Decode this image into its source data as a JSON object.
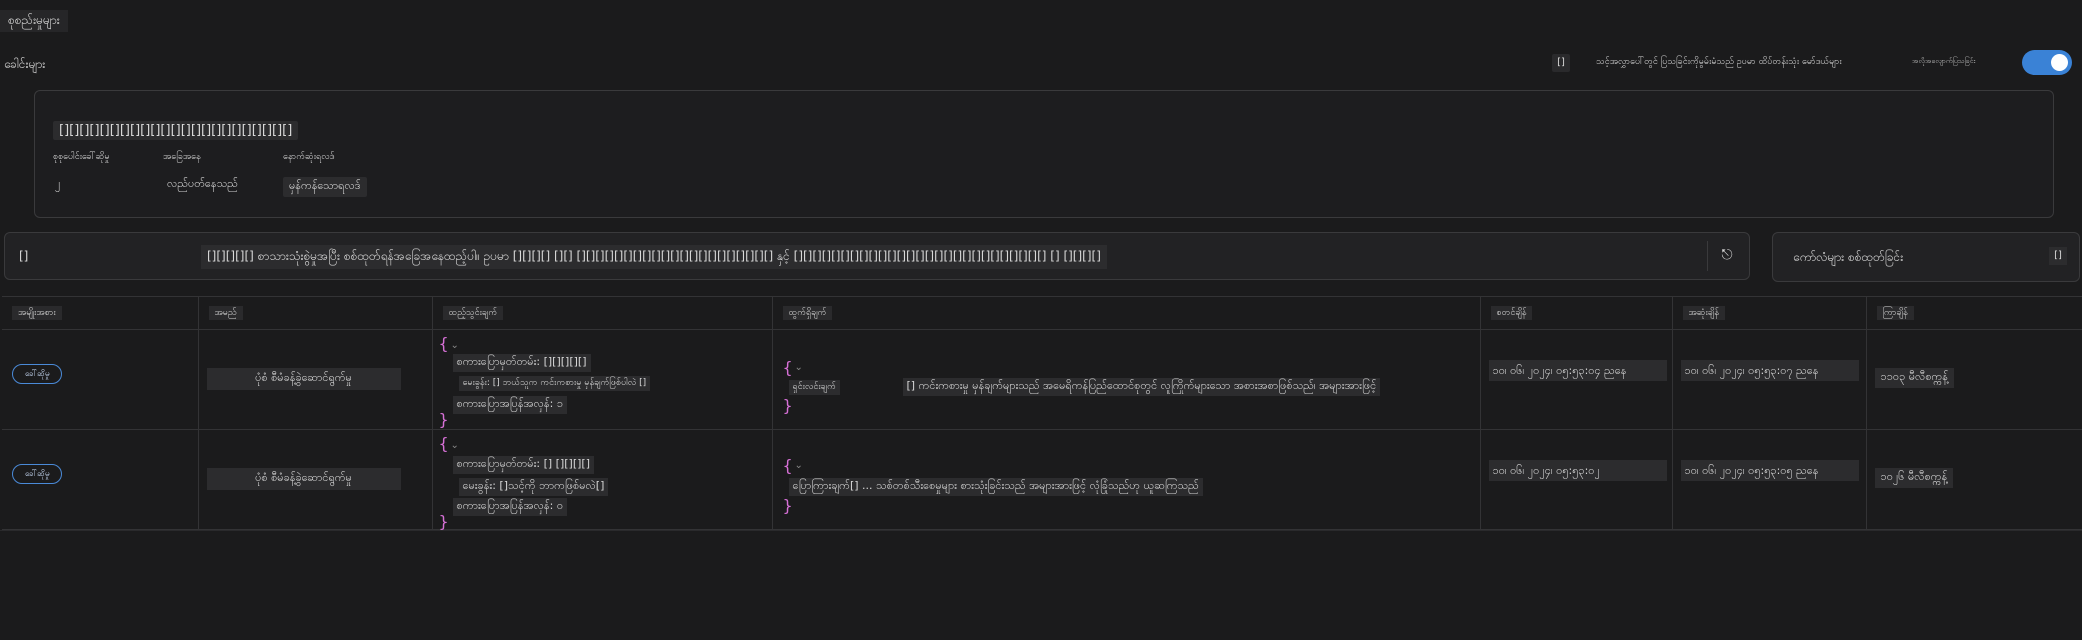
{
  "app": {
    "title": "စုစည်းမှုများ",
    "section_label": "ခေါင်းများ"
  },
  "toolbar": {
    "info_icon": "[]",
    "info_text": "သင့်အလွှာပေါ်တွင် ပြသခြင်းကိုမွမ်းမံသည် ဥပမာ ထိပ်တန်းသုံး မော်ဒယ်များ",
    "toggle_label": "အလိုအလျောက်ပြသခြင်း",
    "toggle_on": true,
    "accent_color": "#3a82d6"
  },
  "card": {
    "title": "[][][][][][][][][][][][][][][][][][][][][][][]",
    "columns": [
      {
        "label": "စုစုပေါင်းခေါ်ဆိုမှု",
        "value": "၂"
      },
      {
        "label": "အခြေအနေ",
        "value": "လည်ပတ်နေသည်"
      },
      {
        "label": "နောက်ဆုံးရလဒ်",
        "value": "မှန်ကန်သောရလဒ်"
      }
    ]
  },
  "prompt": {
    "left_icon": "[]",
    "text": "[][][][][] စာသားသုံးစွဲမှုအပြီး စစ်ထုတ်ရန်အခြေအနေထည့်ပါ။ ဥပမာ [][][][] [][] [][][][][][][][][][][][][][][][][][][][][] နှင့် [][][][][][][][][][][][][][][][][][][][][][][][][][][] [] [][][][]",
    "send_icon": "send-icon"
  },
  "run": {
    "label": "ကော်လံများ စစ်ထုတ်ခြင်း",
    "icon": "[]"
  },
  "table": {
    "headers": [
      "အမျိုးအစား",
      "အမည်",
      "ထည့်သွင်းချက်",
      "ထွက်ရှိချက်",
      "စတင်ချိန်",
      "အဆုံးချိန်",
      "ကြာချိန်"
    ],
    "rows": [
      {
        "type_badge": "ခေါ်ဆိုမှု",
        "name": "ပုံစံ စီမံခန့်ခွဲဆောင်ရွက်မှု",
        "input_lines": [
          "စကားပြောမှတ်တမ်း: [][][][][]",
          "မေးခွန်း: [] ဘယ်သူက ကင်းကစားမှု မှန်ချက်ဖြစ်ပါလဲ []",
          "စကားပြောအပြန်အလှန်: ၁"
        ],
        "output_key": "ရှင်းလင်းချက်",
        "output_text": "[] ကင်းကစားမှု မှန်ချက်များသည် အမေရိကန်ပြည်ထောင်စုတွင် လူကြိုက်များသော အစားအစာဖြစ်သည်၊ အများအားဖြင့်",
        "start": "၁၀၊ ၀၆၊ ၂၀၂၄၊ ၀၅:၅၃:၀၄ ညနေ",
        "end": "၁၀၊ ၀၆၊ ၂၀၂၄၊ ၀၅:၅၃:၀၇ ညနေ",
        "latency": "၁၁၀၃ မီလီစက္ကန့်"
      },
      {
        "type_badge": "ခေါ်ဆိုမှု",
        "name": "ပုံစံ စီမံခန့်ခွဲဆောင်ရွက်မှု",
        "input_lines": [
          "စကားပြောမှတ်တမ်း: [] [][][][]",
          "မေးခွန်း: []သင့်ကို ဘာကဖြစ်မလဲ[]",
          "စကားပြောအပြန်အလှန်: ၀"
        ],
        "output_key": "",
        "output_text": "ပြောကြားချက်[] ... သစ်တစ်သီးစေမှုများ စားသုံးခြင်းသည် အများအားဖြင့် လုံခြုံသည်ဟု ယူဆကြသည်",
        "start": "၁၀၊ ၀၆၊ ၂၀၂၄၊ ၀၅:၅၃:၀၂",
        "end": "၁၀၊ ၀၆၊ ၂၀၂၄၊ ၀၅:၅၃:၀၅ ညနေ",
        "latency": "၁၀၂၆ မီလီစက္ကန့်"
      }
    ]
  }
}
